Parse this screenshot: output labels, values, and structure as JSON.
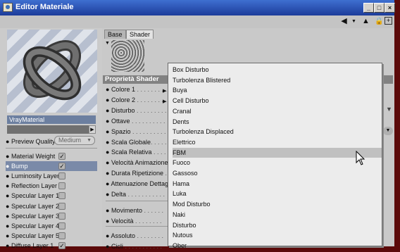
{
  "window": {
    "title": "Editor Materiale"
  },
  "window_buttons": [
    "_",
    "□",
    "×"
  ],
  "left": {
    "material_name": "VrayMaterial",
    "preview_quality_label": "Preview Quality",
    "preview_quality_value": "Medium",
    "channels": [
      {
        "label": "Material Weight",
        "checked": true,
        "mark": "✓"
      },
      {
        "label": "Bump",
        "checked": true,
        "selected": true,
        "mark": "✓"
      },
      {
        "label": "Luminosity Layer",
        "checked": false,
        "mark": ""
      },
      {
        "label": "Reflection Layer",
        "checked": false,
        "mark": ""
      },
      {
        "label": "Specular Layer 1",
        "checked": false,
        "mark": ""
      },
      {
        "label": "Specular Layer 2",
        "checked": false,
        "mark": ""
      },
      {
        "label": "Specular Layer 3",
        "checked": false,
        "mark": ""
      },
      {
        "label": "Specular Layer 4",
        "checked": false,
        "mark": ""
      },
      {
        "label": "Specular Layer 5",
        "checked": false,
        "mark": ""
      },
      {
        "label": "Diffuse Layer 1",
        "checked": true,
        "mark": "✓"
      }
    ]
  },
  "tabs": [
    "Base",
    "Shader"
  ],
  "shader": {
    "header": "Proprietà Shader",
    "props": [
      {
        "label": "Colore 1",
        "dots": " . . . . . . . . ."
      },
      {
        "label": "Colore 2",
        "dots": " . . . . . . . . ."
      },
      {
        "label": "Disturbo",
        "dots": " . . . . . . . . ."
      },
      {
        "label": "Ottave",
        "dots": " . . . . . . . . . ."
      },
      {
        "label": "Spazio",
        "dots": " . . . . . . . . . ."
      },
      {
        "label": "Scala Globale",
        "dots": ". . . . . ."
      },
      {
        "label": "Scala Relativa",
        "dots": " . . . . ."
      },
      {
        "label": "Velocità Animazione",
        "dots": ""
      },
      {
        "label": "Durata Ripetizione",
        "dots": " . ."
      },
      {
        "label": "Attenuazione Dettagli",
        "dots": ""
      },
      {
        "label": "Delta",
        "dots": " . . . . . . . . . . ."
      },
      {
        "label": "Movimento",
        "dots": " . . . . . ."
      },
      {
        "label": "Velocità",
        "dots": " . . . . . . . ."
      },
      {
        "label": "Assoluto",
        "dots": " . . . . . . . ."
      },
      {
        "label": "Cicli",
        "dots": " . . . . . . . . . . ."
      }
    ]
  },
  "dropdown": {
    "items": [
      "Box Disturbo",
      "Turbolenza Blistered",
      "Buya",
      "Cell Disturbo",
      "Cranal",
      "Dents",
      "Turbolenza Displaced",
      "Elettrico",
      "FBM",
      "Fuoco",
      "Gassoso",
      "Hama",
      "Luka",
      "Mod Disturbo",
      "Naki",
      "Disturbo",
      "Nutous",
      "Ober"
    ],
    "highlighted": "FBM"
  }
}
